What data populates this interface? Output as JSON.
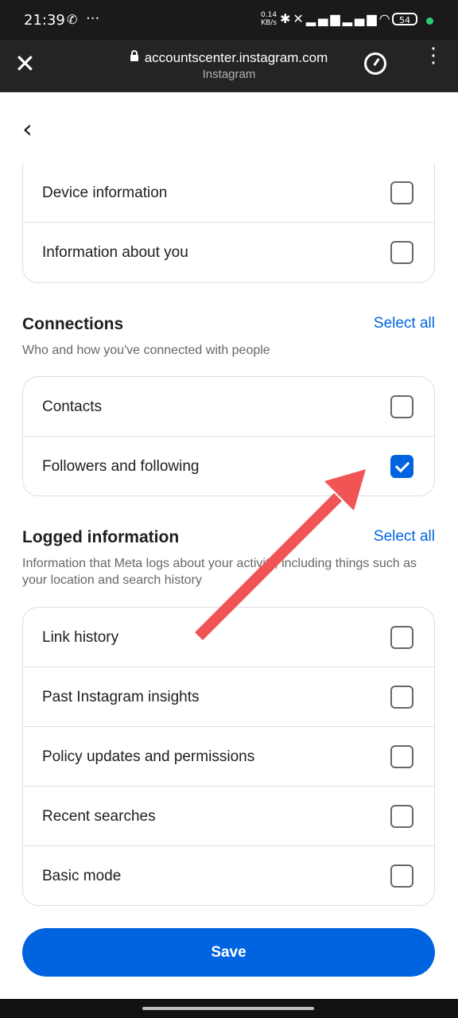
{
  "status_bar": {
    "time": "21:39",
    "net_rate_top": "0.14",
    "net_rate_bottom": "KB/s",
    "battery": "54"
  },
  "browser": {
    "url": "accountscenter.instagram.com",
    "site_name": "Instagram"
  },
  "top_items": [
    {
      "label": "Device information",
      "checked": false
    },
    {
      "label": "Information about you",
      "checked": false
    }
  ],
  "connections": {
    "title": "Connections",
    "select_all": "Select all",
    "description": "Who and how you've connected with people",
    "items": [
      {
        "label": "Contacts",
        "checked": false
      },
      {
        "label": "Followers and following",
        "checked": true
      }
    ]
  },
  "logged_information": {
    "title": "Logged information",
    "select_all": "Select all",
    "description": "Information that Meta logs about your activity, including things such as your location and search history",
    "items": [
      {
        "label": "Link history",
        "checked": false
      },
      {
        "label": "Past Instagram insights",
        "checked": false
      },
      {
        "label": "Policy updates and permissions",
        "checked": false
      },
      {
        "label": "Recent searches",
        "checked": false
      },
      {
        "label": "Basic mode",
        "checked": false
      }
    ]
  },
  "save_label": "Save",
  "colors": {
    "accent": "#0064e0",
    "annotation_arrow": "#f05454"
  }
}
